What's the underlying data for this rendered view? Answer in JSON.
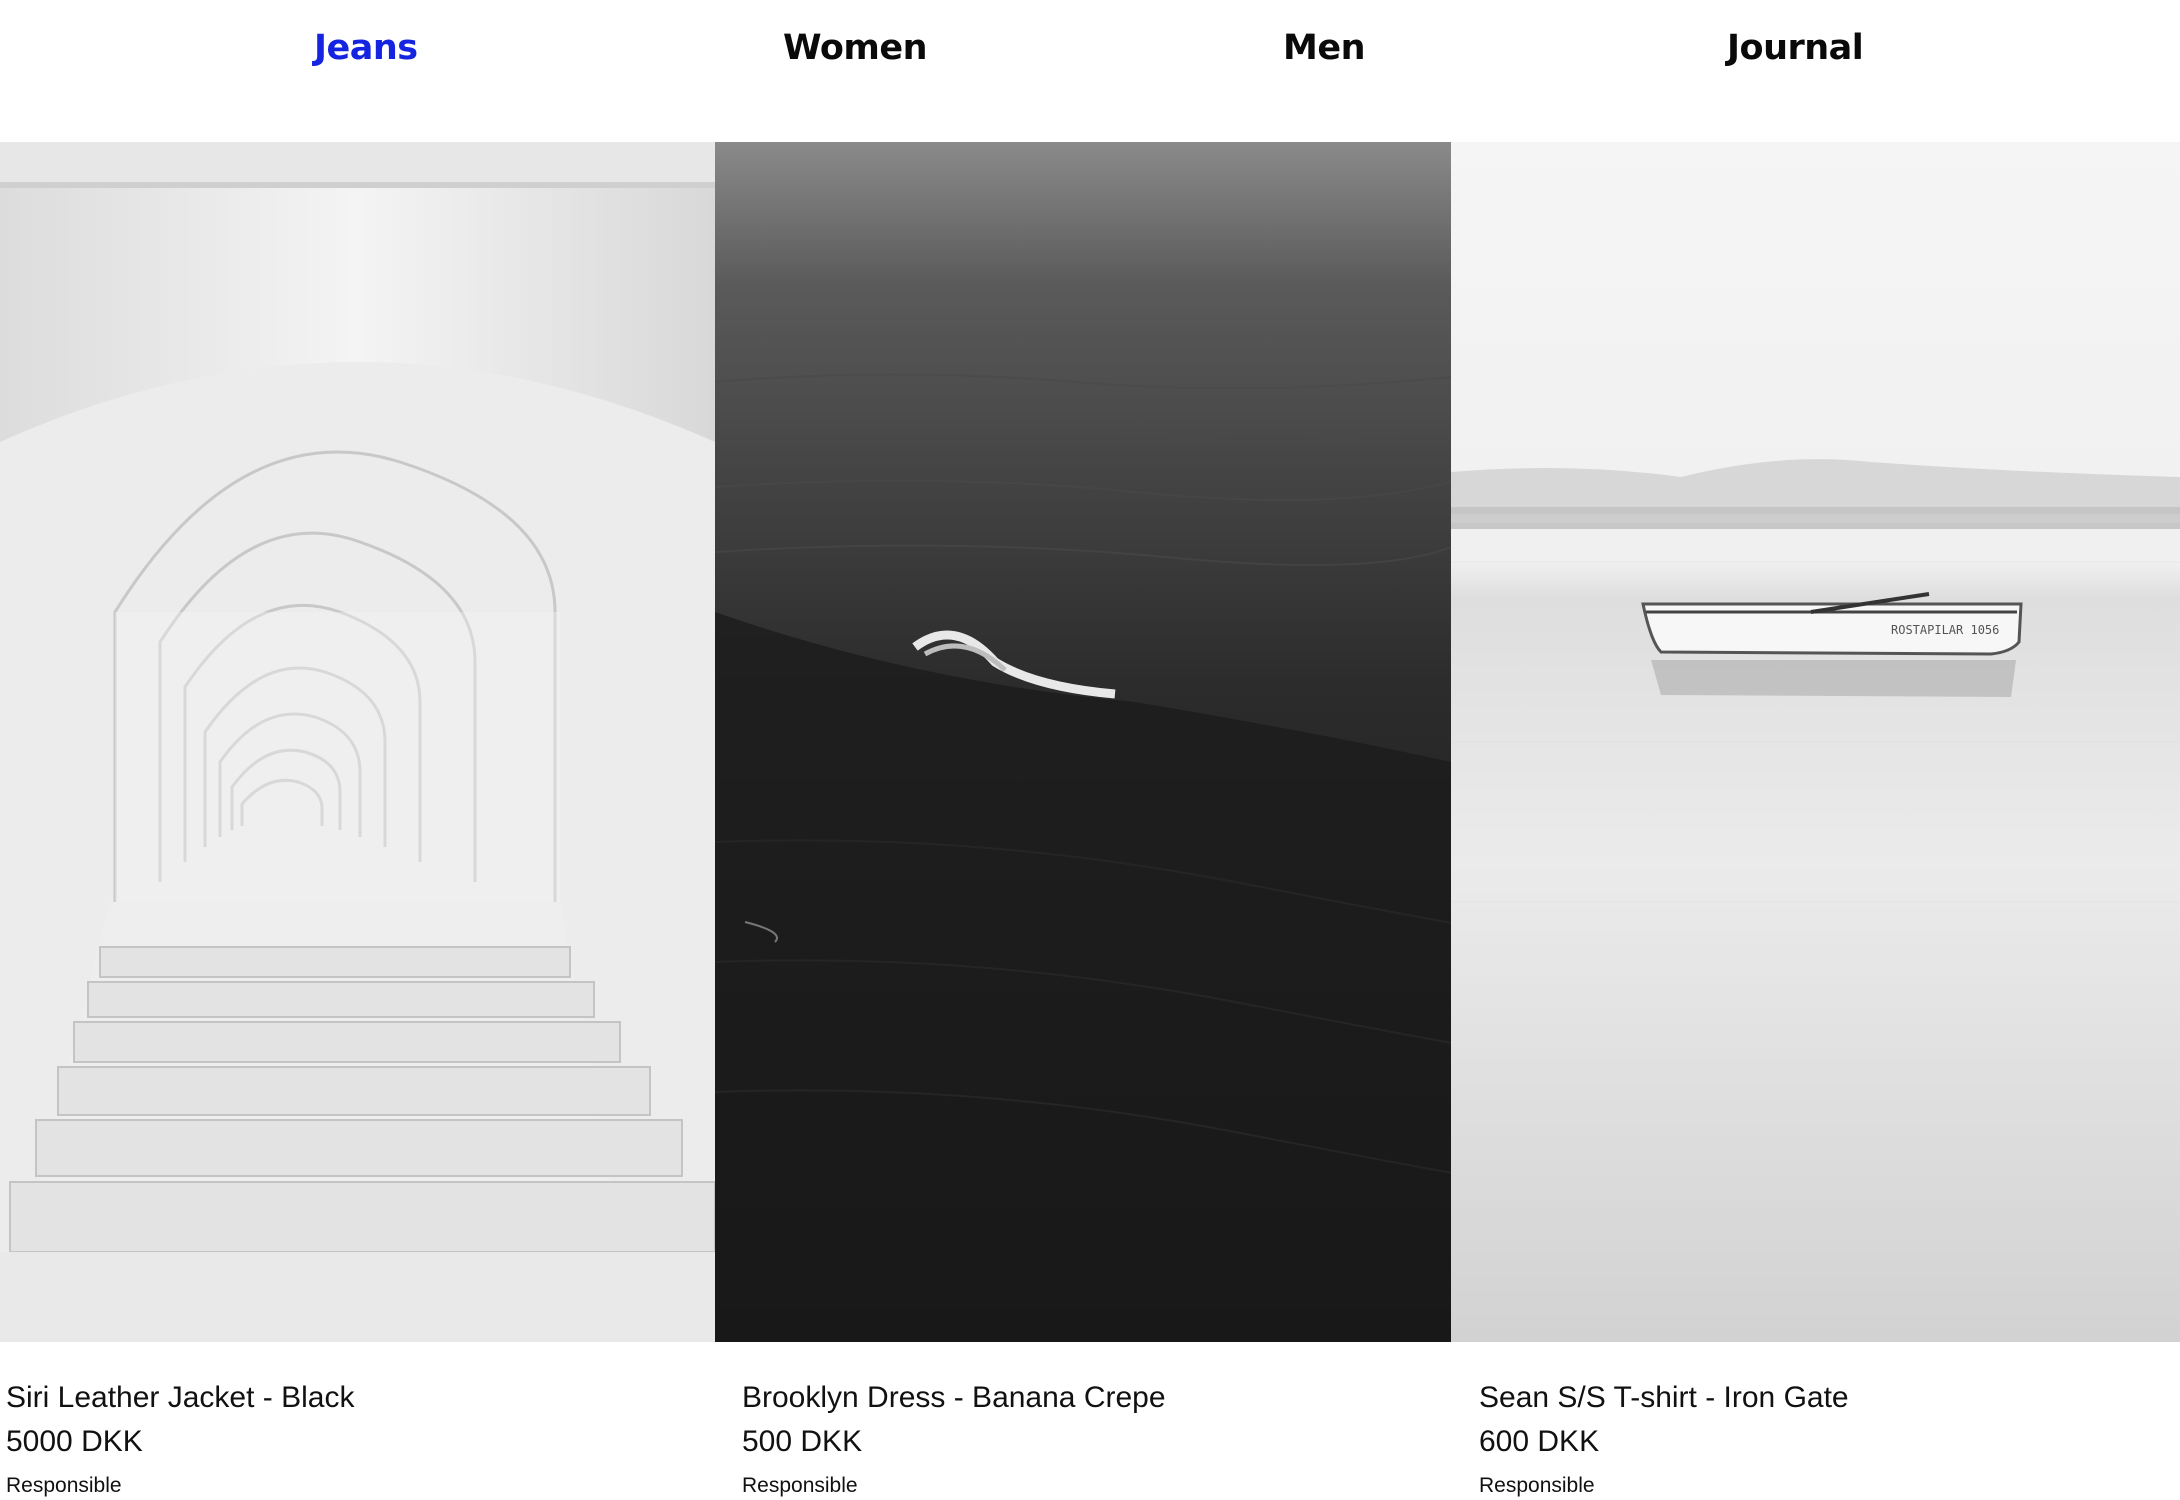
{
  "nav": {
    "items": [
      {
        "label": "Jeans",
        "active": true
      },
      {
        "label": "Women",
        "active": false
      },
      {
        "label": "Men",
        "active": false
      },
      {
        "label": "Journal",
        "active": false
      }
    ],
    "active_color": "#1524e0"
  },
  "products": [
    {
      "title": "Siri Leather Jacket - Black",
      "price": "5000 DKK",
      "tag": "Responsible",
      "image": "white-arches-staircase"
    },
    {
      "title": "Brooklyn Dress - Banana Crepe",
      "price": "500 DKK",
      "tag": "Responsible",
      "image": "dark-ocean-wave"
    },
    {
      "title": "Sean S/S T-shirt - Iron Gate",
      "price": "600 DKK",
      "tag": "Responsible",
      "image": "boat-on-calm-lake"
    }
  ]
}
